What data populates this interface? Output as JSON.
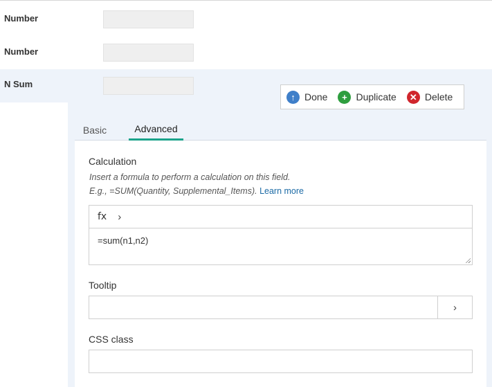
{
  "fields": [
    {
      "label": "Number"
    },
    {
      "label": "Number"
    },
    {
      "label": "N Sum"
    }
  ],
  "actions": {
    "done": "Done",
    "duplicate": "Duplicate",
    "delete": "Delete"
  },
  "tabs": {
    "basic": "Basic",
    "advanced": "Advanced",
    "active": "Advanced"
  },
  "calculation": {
    "title": "Calculation",
    "help_line1": "Insert a formula to perform a calculation on this field.",
    "help_line2": "E.g., =SUM(Quantity, Supplemental_Items).",
    "learn_more": "Learn more",
    "fx_label": "fx",
    "chevron": "›",
    "formula": "=sum(n1,n2)"
  },
  "tooltip": {
    "title": "Tooltip",
    "value": "",
    "chevron": "›"
  },
  "css_class": {
    "title": "CSS class",
    "value": ""
  },
  "colors": {
    "accent": "#1aa38a",
    "selected_bg": "#eef3fa",
    "done": "#3f7fc9",
    "duplicate": "#2e9e3f",
    "delete": "#d0262d",
    "link": "#1b6aa5"
  }
}
